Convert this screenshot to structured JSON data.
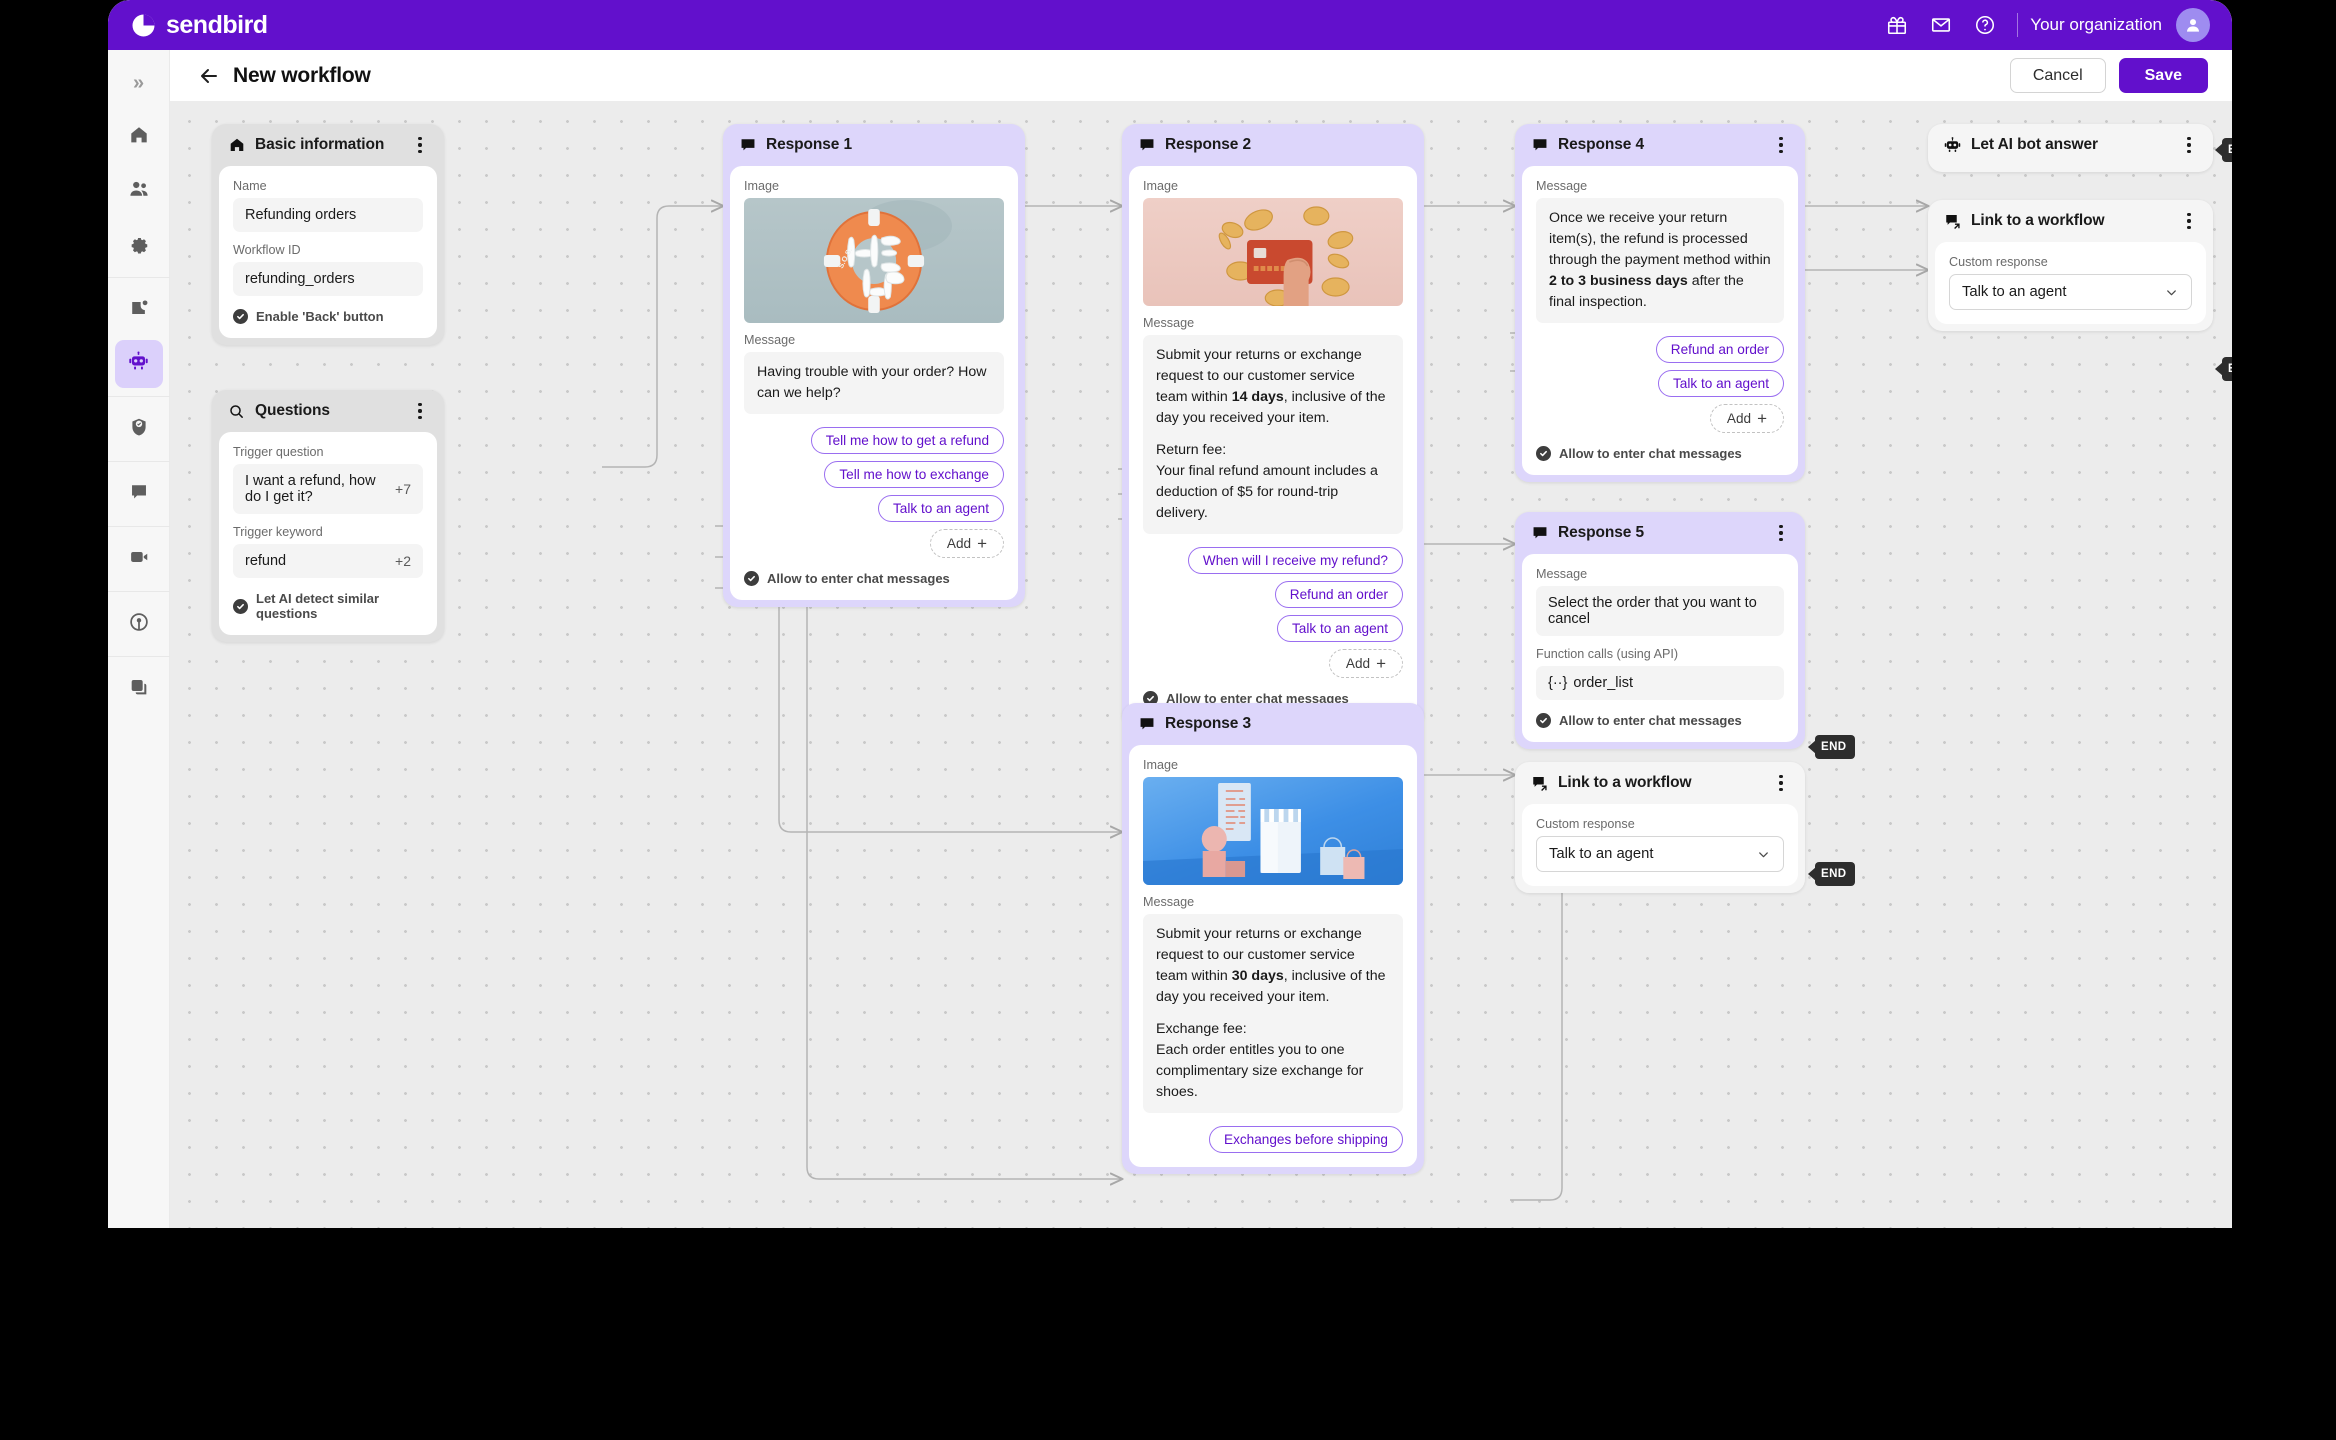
{
  "app": {
    "brand": "sendbird",
    "brand_color": "#6210cc",
    "org_label": "Your organization",
    "icons": {
      "gift": "gift-icon",
      "mail": "mail-icon",
      "help": "help-circle-icon",
      "avatar": "user-avatar-icon"
    }
  },
  "rail": {
    "collapse_label": "»",
    "items": [
      {
        "name": "home",
        "icon": "home-icon",
        "active": false
      },
      {
        "name": "users",
        "icon": "people-icon",
        "active": false
      },
      {
        "name": "settings",
        "icon": "gear-icon",
        "active": false
      },
      {
        "name": "notifications",
        "icon": "notification-icon",
        "active": false
      },
      {
        "name": "ai-chatbot",
        "icon": "robot-icon",
        "active": true
      },
      {
        "name": "moderation",
        "icon": "shield-check-icon",
        "active": false
      },
      {
        "name": "chat",
        "icon": "chat-bubble-icon",
        "active": false
      },
      {
        "name": "calls",
        "icon": "video-camera-icon",
        "active": false
      },
      {
        "name": "live",
        "icon": "broadcast-icon",
        "active": false
      },
      {
        "name": "apps",
        "icon": "layers-icon",
        "active": false
      }
    ]
  },
  "header": {
    "back_icon": "arrow-left-icon",
    "title": "New workflow",
    "cancel_label": "Cancel",
    "save_label": "Save"
  },
  "nodes": {
    "basic_information": {
      "title": "Basic information",
      "icon": "home-icon",
      "name_label": "Name",
      "name_value": "Refunding orders",
      "workflow_id_label": "Workflow ID",
      "workflow_id_value": "refunding_orders",
      "checkbox_label": "Enable 'Back' button"
    },
    "questions": {
      "title": "Questions",
      "icon": "search-icon",
      "trigger_question_label": "Trigger question",
      "trigger_question_value": "I want a refund, how do I get it?",
      "trigger_question_extra": "+7",
      "trigger_keyword_label": "Trigger keyword",
      "trigger_keyword_value": "refund",
      "trigger_keyword_extra": "+2",
      "checkbox_label": "Let AI detect similar questions"
    },
    "response_1": {
      "title": "Response 1",
      "icon": "message-icon",
      "image_label": "Image",
      "image_alt": "orange life ring with HELP and S.O.S. lettering",
      "message_label": "Message",
      "message": "Having trouble with your order? How can we help?",
      "chips": [
        "Tell me how to get a refund",
        "Tell me how to exchange",
        "Talk to an agent"
      ],
      "add_label": "Add",
      "checkbox_label": "Allow to enter chat messages"
    },
    "response_2": {
      "title": "Response 2",
      "icon": "message-icon",
      "image_label": "Image",
      "image_alt": "hand holding a red credit card surrounded by gold coins",
      "message_label": "Message",
      "message_p1_a": "Submit your returns or exchange request to our customer service team within ",
      "message_p1_b": "14 days",
      "message_p1_c": ", inclusive of the day you received your item.",
      "message_p2_a": "Return fee:",
      "message_p2_b": "Your final refund amount includes a deduction of $5 for round-trip delivery.",
      "chips": [
        "When will I receive my refund?",
        "Refund an order",
        "Talk to an agent"
      ],
      "add_label": "Add",
      "checkbox_label": "Allow to enter chat messages"
    },
    "response_3": {
      "title": "Response 3",
      "icon": "message-icon",
      "image_label": "Image",
      "image_alt": "blue storefront scene with receipt and shopping bags",
      "message_label": "Message",
      "message_p1_a": "Submit your returns or exchange request to our customer service team within ",
      "message_p1_b": "30 days",
      "message_p1_c": ", inclusive of the day you received your item.",
      "message_p2_a": "Exchange fee:",
      "message_p2_b": "Each order entitles you to one complimentary size exchange for shoes.",
      "chips": [
        "Exchanges before shipping"
      ]
    },
    "response_4": {
      "title": "Response 4",
      "icon": "message-icon",
      "message_label": "Message",
      "message_a": "Once we receive your return item(s), the refund is processed through the payment method within ",
      "message_b": "2 to 3 business days",
      "message_c": " after the final inspection.",
      "chips": [
        "Refund an order",
        "Talk to an agent"
      ],
      "add_label": "Add",
      "checkbox_label": "Allow to enter chat messages"
    },
    "response_5": {
      "title": "Response 5",
      "icon": "message-icon",
      "message_label": "Message",
      "message": "Select the order that you want to cancel",
      "function_label": "Function calls (using API)",
      "function_value": "order_list",
      "function_prefix": "{··}",
      "checkbox_label": "Allow to enter chat messages"
    },
    "let_ai_bot_answer": {
      "title": "Let AI bot answer",
      "icon": "robot-icon"
    },
    "link_to_workflow_top": {
      "title": "Link to a workflow",
      "icon": "message-link-icon",
      "custom_response_label": "Custom response",
      "custom_response_value": "Talk to an agent"
    },
    "link_to_workflow_bottom": {
      "title": "Link to a workflow",
      "icon": "message-link-icon",
      "custom_response_label": "Custom response",
      "custom_response_value": "Talk to an agent"
    }
  },
  "end_tags": {
    "label": "END",
    "count": 4
  },
  "colors": {
    "brand_purple": "#6210cc",
    "chip_border": "#9a6ef0",
    "node_lilac": "#ddd6fb",
    "node_grey": "#e0e0e0",
    "canvas": "#ececec"
  }
}
